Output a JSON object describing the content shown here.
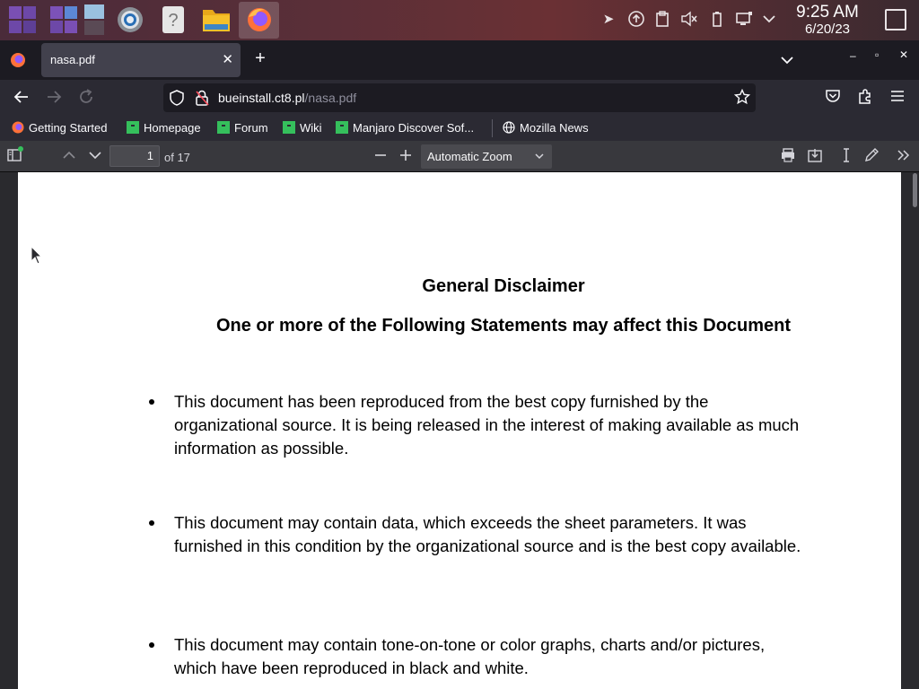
{
  "taskbar": {
    "clock_time": "9:25 AM",
    "clock_date": "6/20/23",
    "launchers": [
      "app-grid-icon",
      "app-grid-icon-2",
      "desktop-pager-icon",
      "system-settings-icon",
      "help-icon",
      "file-manager-icon",
      "firefox-icon"
    ],
    "tray": [
      "kde-connect-icon",
      "updates-icon",
      "clipboard-icon",
      "volume-muted-icon",
      "battery-icon",
      "network-icon",
      "tray-expand-icon"
    ]
  },
  "browser": {
    "tab_title": "nasa.pdf",
    "url_host": "bueinstall.ct8.pl",
    "url_path": "/nasa.pdf",
    "bookmarks": [
      "Getting Started",
      "Homepage",
      "Forum",
      "Wiki",
      "Manjaro Discover Sof...",
      "Mozilla News"
    ]
  },
  "pdf_toolbar": {
    "page_number": "1",
    "page_count": "of 17",
    "zoom": "Automatic Zoom"
  },
  "document": {
    "title": "General Disclaimer",
    "subtitle": "One or more of the Following Statements may affect this Document",
    "bullets": [
      "This document has been reproduced from the best copy furnished by the organizational source. It is being released in the interest of making available as much information as possible.",
      "This document may contain data, which exceeds the sheet parameters. It was furnished in this condition by the organizational source and is the best copy available.",
      "This document may contain tone-on-tone or color graphs, charts and/or pictures, which have been reproduced in black and white."
    ]
  },
  "colors": {
    "accent": "#35bf5c",
    "toolbar": "#2b2a33",
    "pdf_toolbar": "#38383d"
  }
}
